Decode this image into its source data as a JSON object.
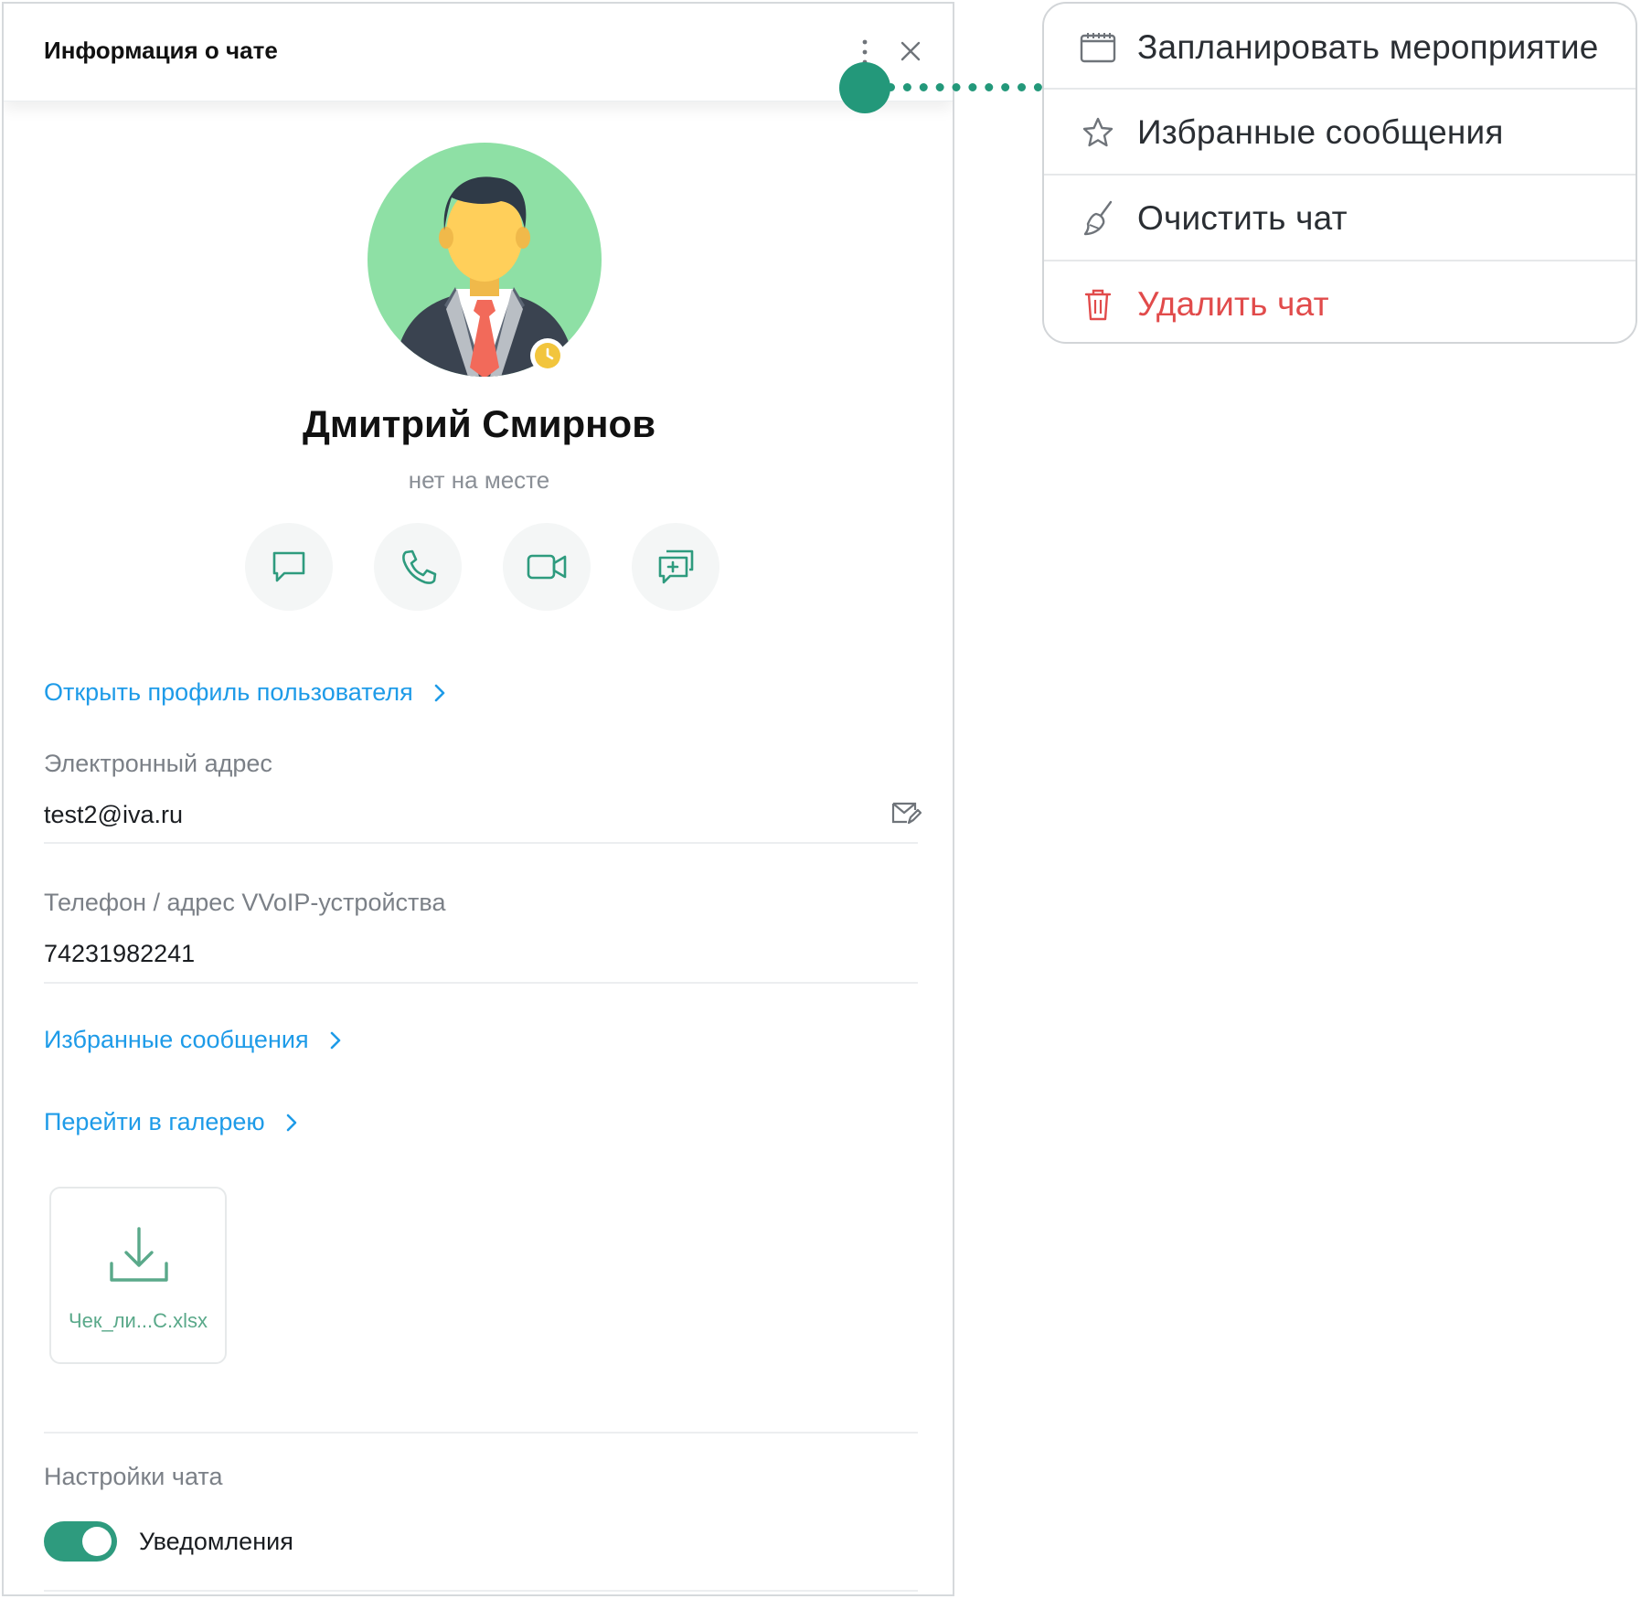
{
  "header": {
    "title": "Информация о чате"
  },
  "profile": {
    "name": "Дмитрий Смирнов",
    "status": "нет на месте"
  },
  "actions": [
    {
      "icon": "chat-bubble-icon"
    },
    {
      "icon": "phone-icon"
    },
    {
      "icon": "video-camera-icon"
    },
    {
      "icon": "add-chat-icon"
    }
  ],
  "links": {
    "open_profile": "Открыть профиль пользователя",
    "favorites": "Избранные сообщения",
    "gallery": "Перейти в галерею"
  },
  "fields": {
    "email_label": "Электронный адрес",
    "email_value": "test2@iva.ru",
    "phone_label": "Телефон / адрес VVoIP-устройства",
    "phone_value": "74231982241"
  },
  "gallery_file": {
    "name": "Чек_ли...С.xlsx",
    "icon": "download-icon"
  },
  "settings": {
    "title": "Настройки чата",
    "notifications_label": "Уведомления",
    "notifications_enabled": true
  },
  "menu": {
    "items": [
      {
        "label": "Запланировать мероприятие",
        "icon": "calendar-icon",
        "danger": false
      },
      {
        "label": "Избранные сообщения",
        "icon": "star-icon",
        "danger": false
      },
      {
        "label": "Очистить чат",
        "icon": "broom-icon",
        "danger": false
      },
      {
        "label": "Удалить чат",
        "icon": "trash-icon",
        "danger": true
      }
    ]
  },
  "colors": {
    "accent": "#23987a",
    "link": "#1e9be8",
    "danger": "#e14b4b",
    "toggle_on": "#2e9b7e",
    "status_away": "#f2c53d",
    "avatar_bg": "#8ee0a5"
  }
}
